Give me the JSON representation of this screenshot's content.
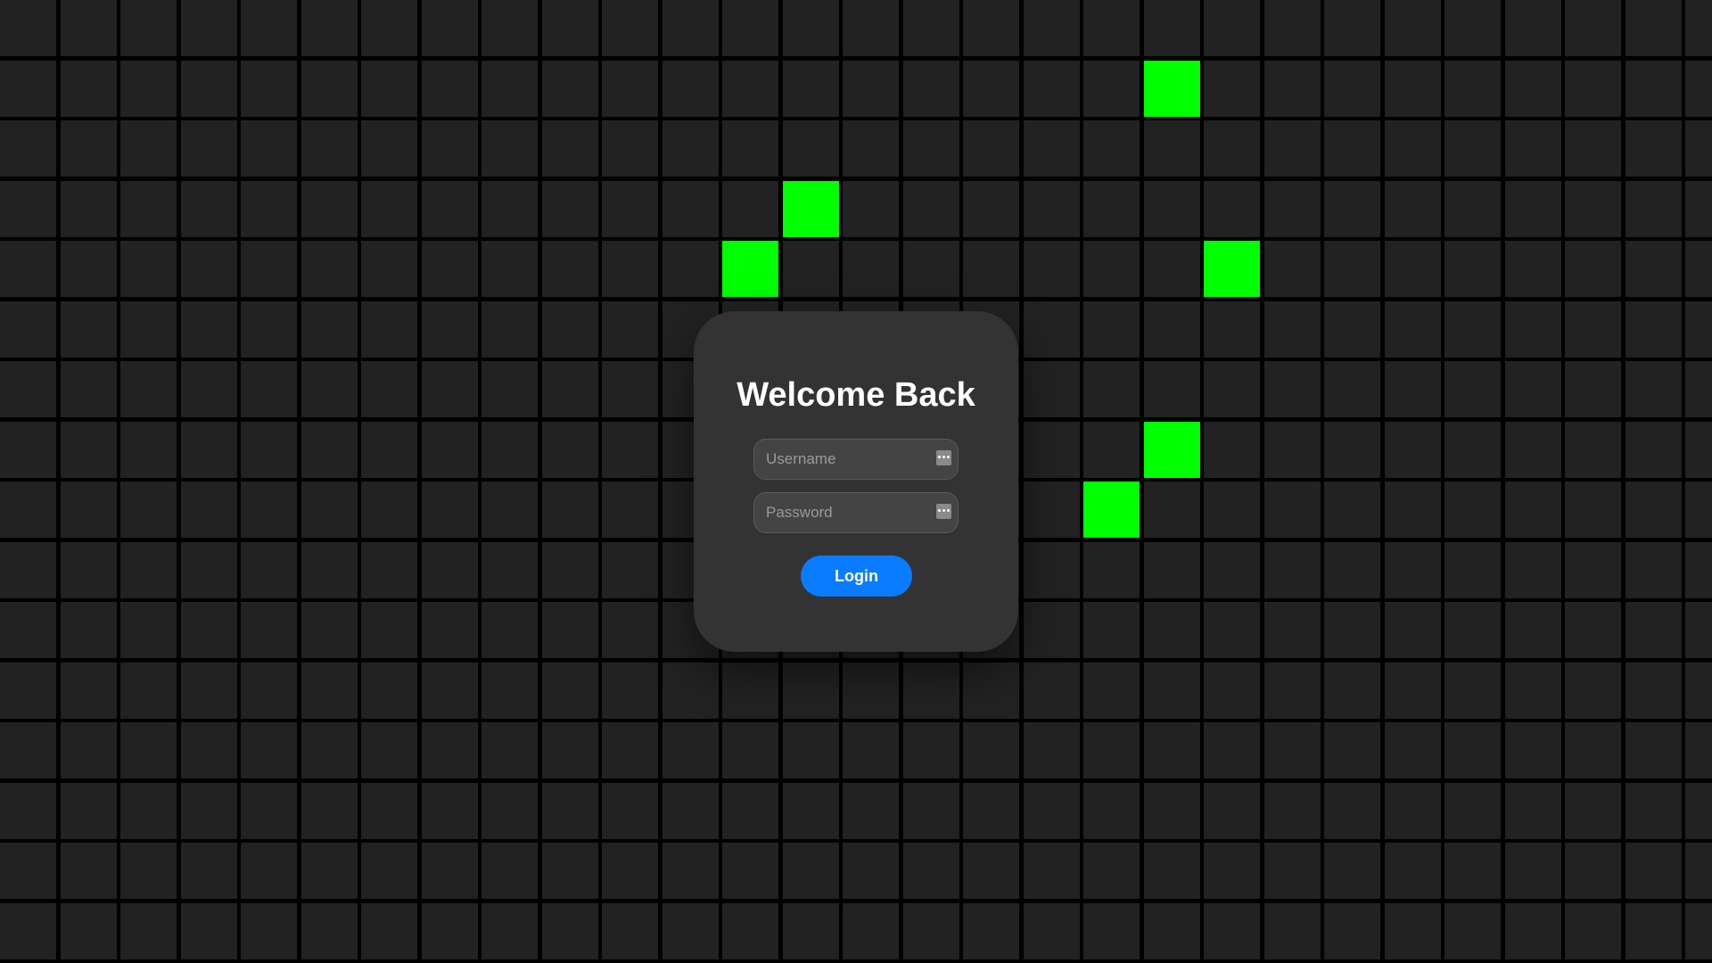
{
  "colors": {
    "background": "#000000",
    "cell": "#222222",
    "lit_cell": "#00ff00",
    "card": "#333333",
    "accent": "#0a7cff"
  },
  "grid": {
    "columns": 29,
    "rows": 16,
    "lit_cells": [
      {
        "col": 19,
        "row": 1
      },
      {
        "col": 13,
        "row": 3
      },
      {
        "col": 12,
        "row": 4
      },
      {
        "col": 20,
        "row": 4
      },
      {
        "col": 19,
        "row": 7
      },
      {
        "col": 18,
        "row": 8
      }
    ]
  },
  "login": {
    "title": "Welcome Back",
    "username": {
      "value": "",
      "placeholder": "Username",
      "icon": "password-manager-icon"
    },
    "password": {
      "value": "",
      "placeholder": "Password",
      "icon": "password-manager-icon"
    },
    "submit_label": "Login"
  }
}
